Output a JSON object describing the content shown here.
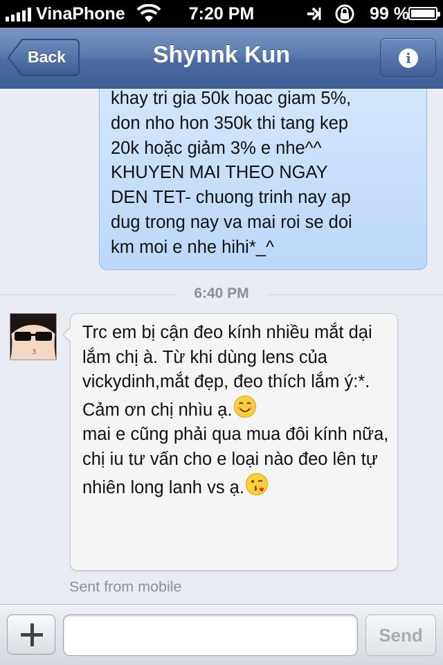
{
  "status_bar": {
    "carrier": "VinaPhone",
    "time": "7:20 PM",
    "battery_percent": "99 %",
    "battery_level": 0.99
  },
  "nav": {
    "back_label": "Back",
    "title": "Shynnk Kun"
  },
  "conversation": {
    "outgoing_message": {
      "text": "khay tri gia 50k hoac giam 5%,\ndon nho hon 350k thi tang kep\n20k hoặc giảm 3% e nhe^^\nKHUYEN MAI THEO NGAY\nDEN TET- chuong trinh nay ap\ndug trong nay va mai roi se doi\nkm moi e nhe hihi*_^"
    },
    "time_divider": "6:40 PM",
    "incoming_message": {
      "paragraph_1": "Trc em bị cận đeo kính nhiều mắt dại lắm chị à. Từ khi dùng lens của vickydinh,mắt đẹp, đeo thích lắm ý:*. Cảm ơn chị nhìu ạ.",
      "paragraph_2": "mai e cũng phải qua mua đôi kính nữa, chị iu tư vấn cho e loại nào đeo lên tự nhiên long lanh vs ạ."
    },
    "sent_from": "Sent from mobile"
  },
  "compose": {
    "input_value": "",
    "send_label": "Send"
  },
  "colors": {
    "nav_blue": "#4a6aa2",
    "outgoing_bubble": "#c9def8",
    "incoming_bubble": "#f5f5f5",
    "background": "#e9edf3"
  }
}
